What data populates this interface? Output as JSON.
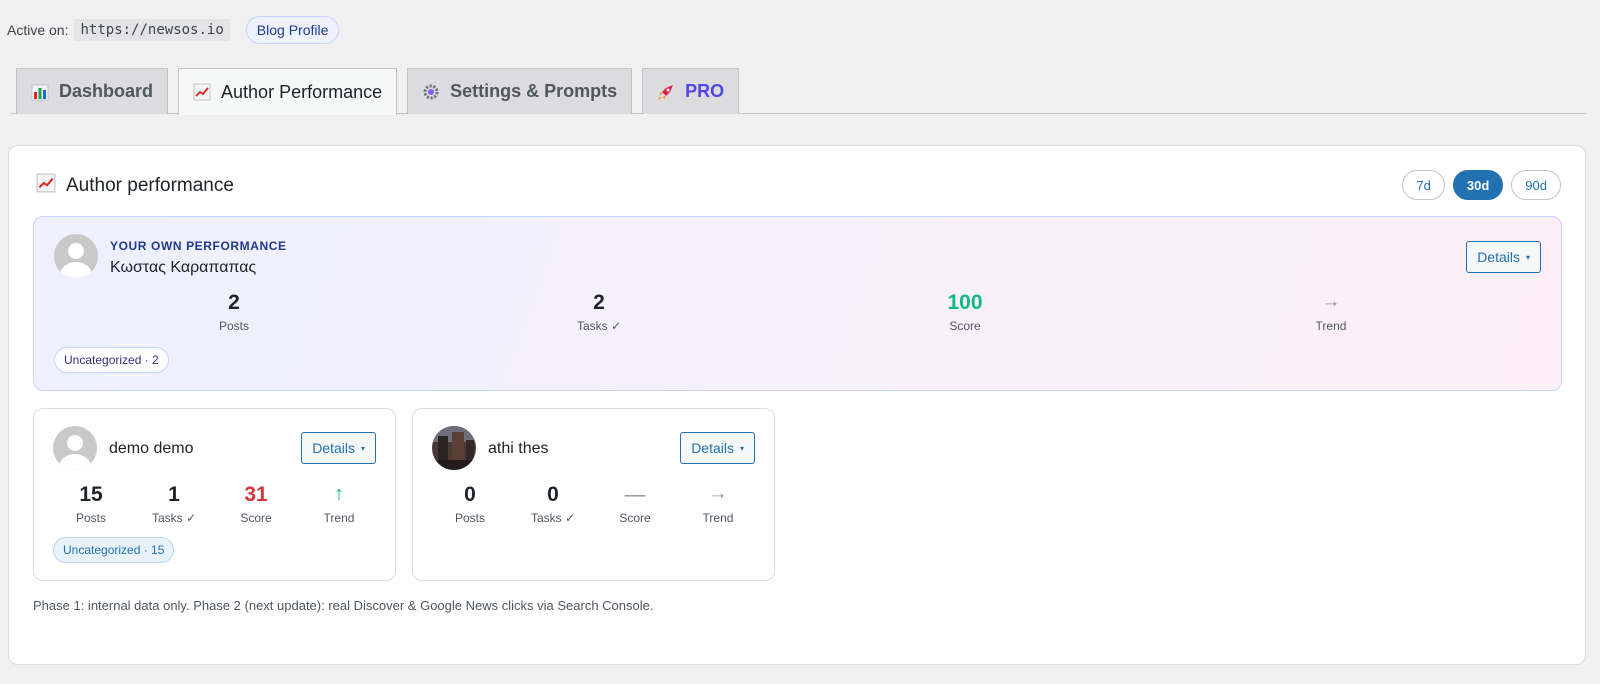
{
  "topbar": {
    "active_label": "Active on:",
    "active_url": "https://newsos.io",
    "profile_pill": "Blog Profile"
  },
  "tabs": [
    {
      "label": "Dashboard",
      "icon": "bar-chart-icon"
    },
    {
      "label": "Author Performance",
      "icon": "line-chart-icon",
      "active": true
    },
    {
      "label": "Settings & Prompts",
      "icon": "gear-icon"
    },
    {
      "label": "PRO",
      "icon": "rocket-icon"
    }
  ],
  "panel": {
    "title": "Author performance",
    "title_icon": "line-chart-icon",
    "ranges": [
      "7d",
      "30d",
      "90d"
    ],
    "active_range": "30d"
  },
  "own": {
    "eyebrow": "YOUR OWN PERFORMANCE",
    "name": "Κωστας Καραπαπας",
    "details_label": "Details",
    "caret": "▾",
    "stats": {
      "posts": {
        "value": "2",
        "label": "Posts"
      },
      "tasks": {
        "value": "2",
        "label": "Tasks ✓"
      },
      "score": {
        "value": "100",
        "label": "Score"
      },
      "trend": {
        "value": "→",
        "label": "Trend"
      }
    },
    "tag": "Uncategorized · 2"
  },
  "authors": [
    {
      "name": "demo demo",
      "details_label": "Details",
      "caret": "▾",
      "stats": {
        "posts": {
          "value": "15",
          "label": "Posts"
        },
        "tasks": {
          "value": "1",
          "label": "Tasks ✓"
        },
        "score": {
          "value": "31",
          "label": "Score"
        },
        "trend": {
          "value": "↑",
          "label": "Trend"
        }
      },
      "tag": "Uncategorized · 15"
    },
    {
      "name": "athi thes",
      "details_label": "Details",
      "caret": "▾",
      "stats": {
        "posts": {
          "value": "0",
          "label": "Posts"
        },
        "tasks": {
          "value": "0",
          "label": "Tasks ✓"
        },
        "score": {
          "value": "—",
          "label": "Score"
        },
        "trend": {
          "value": "→",
          "label": "Trend"
        }
      }
    }
  ],
  "footnote": "Phase 1: internal data only. Phase 2 (next update): real Discover & Google News clicks via Search Console.",
  "colors": {
    "accent": "#2271b1",
    "score_good": "#10b981",
    "score_bad": "#d63638",
    "pro": "#4f46e5"
  }
}
